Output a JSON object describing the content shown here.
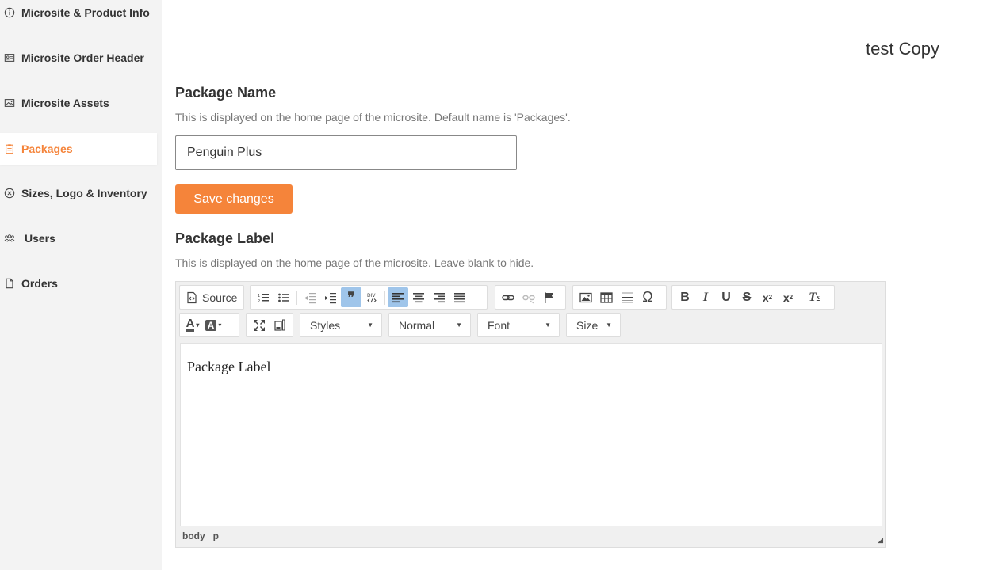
{
  "doc_title": "test Copy",
  "sidebar": {
    "items": [
      {
        "label": "Microsite & Product Info",
        "icon": "info-icon"
      },
      {
        "label": "Microsite Order Header",
        "icon": "id-card-icon"
      },
      {
        "label": "Microsite Assets",
        "icon": "image-icon"
      },
      {
        "label": "Packages",
        "icon": "clipboard-icon",
        "active": true
      },
      {
        "label": "Sizes, Logo & Inventory",
        "icon": "close-circle-icon"
      },
      {
        "label": "Users",
        "icon": "users-icon"
      },
      {
        "label": "Orders",
        "icon": "file-icon"
      }
    ]
  },
  "package_name": {
    "title": "Package Name",
    "help": "This is displayed on the home page of the microsite. Default name is 'Packages'.",
    "value": "Penguin Plus",
    "save_label": "Save changes"
  },
  "package_label": {
    "title": "Package Label",
    "help": "This is displayed on the home page of the microsite. Leave blank to hide."
  },
  "editor": {
    "source_label": "Source",
    "combos": {
      "styles": "Styles",
      "format": "Normal",
      "font": "Font",
      "size": "Size"
    },
    "content": "Package Label",
    "path": [
      "body",
      "p"
    ]
  },
  "colors": {
    "accent": "#f5843a",
    "sidebar_bg": "#f3f3f3",
    "active_btn": "#9fc5ea"
  }
}
